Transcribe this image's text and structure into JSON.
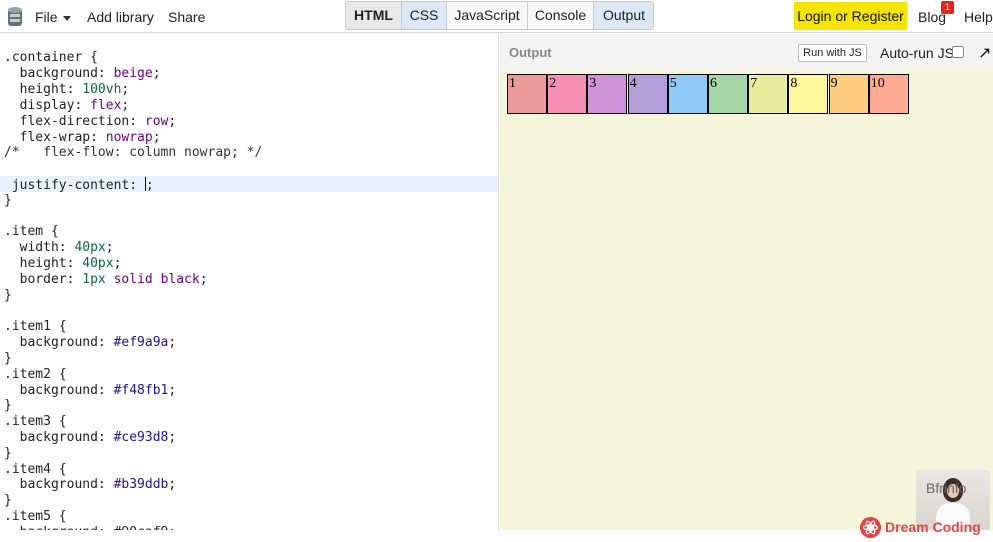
{
  "topbar": {
    "menu": [
      {
        "label": "File"
      },
      {
        "label": "Add library"
      },
      {
        "label": "Share"
      }
    ],
    "tabs": [
      "HTML",
      "CSS",
      "JavaScript",
      "Console",
      "Output"
    ],
    "login_label": "Login or Register",
    "blog_label": "Blog",
    "blog_badge": "1",
    "help_label": "Help"
  },
  "editor": {
    "lines": [
      {
        "parts": [
          [
            ".container {",
            ""
          ]
        ]
      },
      {
        "parts": [
          [
            "  background: ",
            ""
          ],
          [
            "beige",
            "kw"
          ],
          [
            ";",
            ""
          ]
        ]
      },
      {
        "parts": [
          [
            "  height: ",
            ""
          ],
          [
            "100vh",
            "num"
          ],
          [
            ";",
            ""
          ]
        ]
      },
      {
        "parts": [
          [
            "  display: ",
            ""
          ],
          [
            "flex",
            "kw"
          ],
          [
            ";",
            ""
          ]
        ]
      },
      {
        "parts": [
          [
            "  flex-direction: ",
            ""
          ],
          [
            "row",
            "kw"
          ],
          [
            ";",
            ""
          ]
        ]
      },
      {
        "parts": [
          [
            "  flex-wrap: ",
            ""
          ],
          [
            "nowrap",
            "kw"
          ],
          [
            ";",
            ""
          ]
        ]
      },
      {
        "parts": [
          [
            "/*   flex-flow: column nowrap; */",
            "cm"
          ]
        ]
      },
      {
        "parts": [
          [
            "",
            ""
          ]
        ]
      },
      {
        "parts": [
          [
            " justify-content: ",
            ""
          ],
          [
            "|",
            "cursor"
          ],
          [
            ";",
            ""
          ]
        ]
      },
      {
        "parts": [
          [
            "}",
            ""
          ]
        ]
      },
      {
        "parts": [
          [
            "",
            ""
          ]
        ]
      },
      {
        "parts": [
          [
            ".item {",
            ""
          ]
        ]
      },
      {
        "parts": [
          [
            "  width: ",
            ""
          ],
          [
            "40px",
            "num"
          ],
          [
            ";",
            ""
          ]
        ]
      },
      {
        "parts": [
          [
            "  height: ",
            ""
          ],
          [
            "40px",
            "num"
          ],
          [
            ";",
            ""
          ]
        ]
      },
      {
        "parts": [
          [
            "  border: ",
            ""
          ],
          [
            "1px",
            "num"
          ],
          [
            " solid ",
            "kw"
          ],
          [
            "black",
            "kw"
          ],
          [
            ";",
            ""
          ]
        ]
      },
      {
        "parts": [
          [
            "}",
            ""
          ]
        ]
      },
      {
        "parts": [
          [
            "",
            ""
          ]
        ]
      },
      {
        "parts": [
          [
            ".item1 {",
            ""
          ]
        ]
      },
      {
        "parts": [
          [
            "  background: ",
            ""
          ],
          [
            "#ef9a9a",
            "hex"
          ],
          [
            ";",
            ""
          ]
        ]
      },
      {
        "parts": [
          [
            "}",
            ""
          ]
        ]
      },
      {
        "parts": [
          [
            ".item2 {",
            ""
          ]
        ]
      },
      {
        "parts": [
          [
            "  background: ",
            ""
          ],
          [
            "#f48fb1",
            "hex"
          ],
          [
            ";",
            ""
          ]
        ]
      },
      {
        "parts": [
          [
            "}",
            ""
          ]
        ]
      },
      {
        "parts": [
          [
            ".item3 {",
            ""
          ]
        ]
      },
      {
        "parts": [
          [
            "  background: ",
            ""
          ],
          [
            "#ce93d8",
            "hex"
          ],
          [
            ";",
            ""
          ]
        ]
      },
      {
        "parts": [
          [
            "}",
            ""
          ]
        ]
      },
      {
        "parts": [
          [
            ".item4 {",
            ""
          ]
        ]
      },
      {
        "parts": [
          [
            "  background: ",
            ""
          ],
          [
            "#b39ddb",
            "hex"
          ],
          [
            ";",
            ""
          ]
        ]
      },
      {
        "parts": [
          [
            "}",
            ""
          ]
        ]
      },
      {
        "parts": [
          [
            ".item5 {",
            ""
          ]
        ]
      },
      {
        "parts": [
          [
            "  background: #90caf9;",
            ""
          ]
        ]
      }
    ]
  },
  "output": {
    "title": "Output",
    "run_label": "Run with JS",
    "autorun_label": "Auto-run JS",
    "autorun_checked": false,
    "expand_icon": "expand-arrow-icon",
    "items": [
      {
        "label": "1",
        "color": "#ef9a9a"
      },
      {
        "label": "2",
        "color": "#f48fb1"
      },
      {
        "label": "3",
        "color": "#ce93d8"
      },
      {
        "label": "4",
        "color": "#b39ddb"
      },
      {
        "label": "5",
        "color": "#90caf9"
      },
      {
        "label": "6",
        "color": "#a5d6a7"
      },
      {
        "label": "7",
        "color": "#e6ee9c"
      },
      {
        "label": "8",
        "color": "#fff59d"
      },
      {
        "label": "9",
        "color": "#ffcc80"
      },
      {
        "label": "10",
        "color": "#ffab91"
      }
    ]
  },
  "overlay": {
    "avatar_text": "Bfrinfo",
    "brand": "Dream Coding"
  }
}
